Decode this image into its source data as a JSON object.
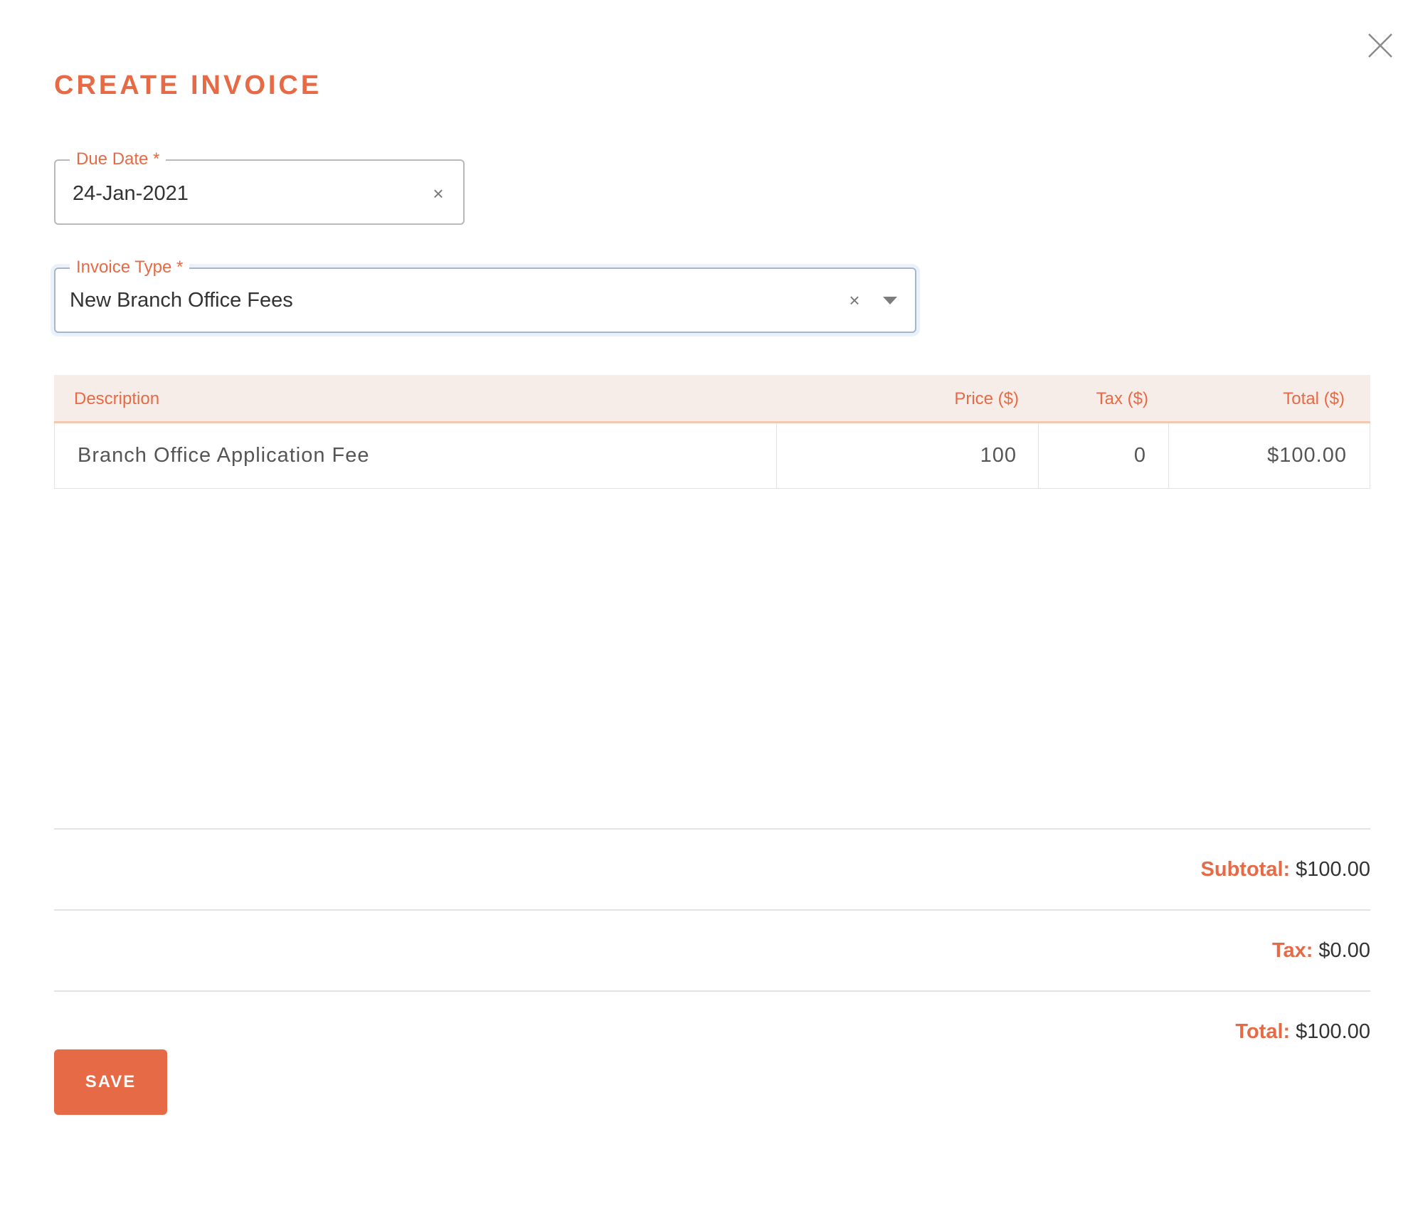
{
  "dialog": {
    "title": "CREATE INVOICE",
    "close_icon": "close-icon"
  },
  "due_date": {
    "label": "Due Date *",
    "value": "24-Jan-2021",
    "clear_glyph": "×"
  },
  "invoice_type": {
    "label": "Invoice Type *",
    "value": "New Branch Office Fees",
    "clear_glyph": "×"
  },
  "table": {
    "headers": {
      "description": "Description",
      "price": "Price ($)",
      "tax": "Tax ($)",
      "total": "Total ($)"
    },
    "rows": [
      {
        "description": "Branch Office Application Fee",
        "price": "100",
        "tax": "0",
        "total": "$100.00"
      }
    ]
  },
  "summary": {
    "subtotal_label": "Subtotal:",
    "subtotal_value": "$100.00",
    "tax_label": "Tax:",
    "tax_value": "$0.00",
    "total_label": "Total:",
    "total_value": "$100.00"
  },
  "actions": {
    "save_label": "SAVE"
  },
  "colors": {
    "accent": "#e66a45",
    "header_bg": "#f7ede8"
  }
}
